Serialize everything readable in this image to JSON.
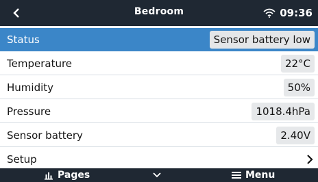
{
  "titlebar": {
    "title": "Bedroom",
    "time": "09:36",
    "icons": {
      "back": "chevron-left-icon",
      "wifi": "wifi-icon"
    }
  },
  "rows": [
    {
      "label": "Status",
      "value": "Sensor battery low"
    },
    {
      "label": "Temperature",
      "value": "22°C"
    },
    {
      "label": "Humidity",
      "value": "50%"
    },
    {
      "label": "Pressure",
      "value": "1018.4hPa"
    },
    {
      "label": "Sensor battery",
      "value": "2.40V"
    },
    {
      "label": "Setup"
    }
  ],
  "bottombar": {
    "pages_label": "Pages",
    "menu_label": "Menu",
    "icons": {
      "pages": "bar-chart-icon",
      "down": "chevron-down-icon",
      "menu": "hamburger-menu-icon"
    }
  },
  "colors": {
    "titlebar_bg": "#1f2833",
    "selected_row_bg": "#3b86c8",
    "value_box_bg": "#e6e8ea"
  }
}
